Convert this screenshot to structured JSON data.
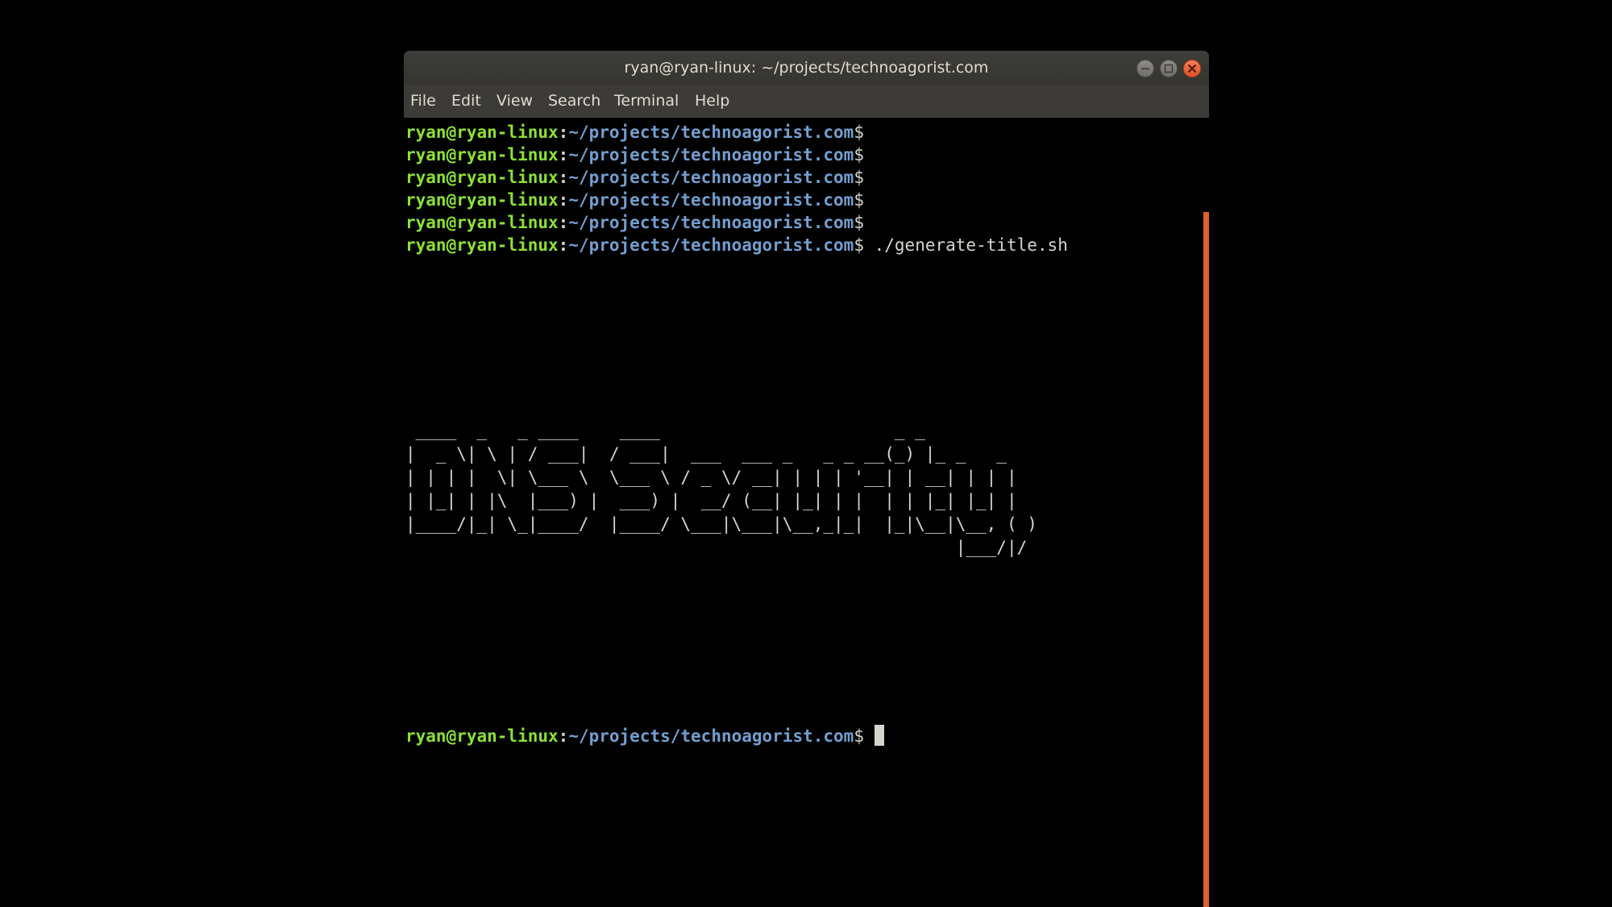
{
  "window": {
    "title": "ryan@ryan-linux: ~/projects/technoagorist.com"
  },
  "menu": [
    "File",
    "Edit",
    "View",
    "Search",
    "Terminal",
    "Help"
  ],
  "prompt": {
    "user_host": "ryan@ryan-linux",
    "colon": ":",
    "path": "~/projects/technoagorist.com",
    "dollar": "$"
  },
  "command": " ./generate-title.sh",
  "ascii_art": " ____  _   _ ____    ____                       _ _\n|  _ \\| \\ | / ___|  / ___|  ___  ___ _   _ _ __(_) |_ _   _\n| | | |  \\| \\___ \\  \\___ \\ / _ \\/ __| | | | '__| | __| | | |\n| |_| | |\\  |___) |  ___) |  __/ (__| |_| | |  | | |_| |_| |\n|____/|_| \\_|____/  |____/ \\___|\\___|\\__,_|_|  |_|\\__|\\__, ( )\n                                                      |___/|/",
  "colors": {
    "user": "#8ae234",
    "path": "#729fcf",
    "text": "#d3d7cf",
    "scrollbar": "#e05f2c",
    "close_button": "#e95420"
  }
}
